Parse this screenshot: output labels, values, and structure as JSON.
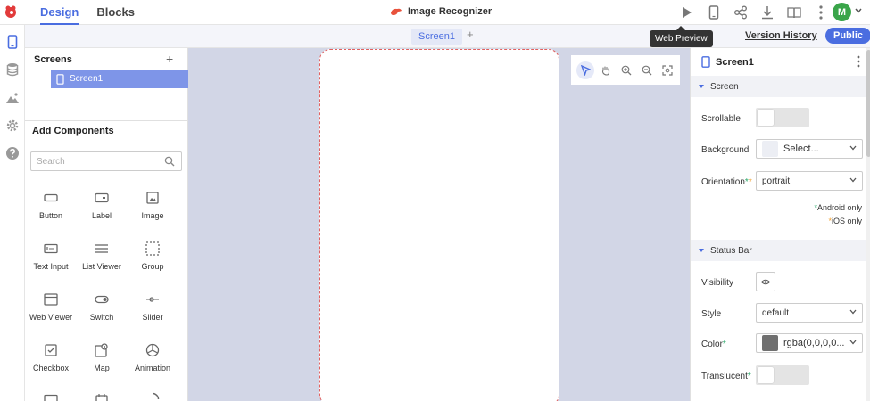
{
  "topbar": {
    "tabs": [
      {
        "label": "Design"
      },
      {
        "label": "Blocks"
      }
    ],
    "project_name": "Image Recognizer",
    "avatar_letter": "M"
  },
  "tabbar": {
    "screen_tab": "Screen1",
    "add": "+",
    "tooltip": "Web Preview",
    "version_history": "Version History",
    "public": "Public"
  },
  "screens_panel": {
    "title": "Screens",
    "add": "+",
    "items": [
      {
        "label": "Screen1"
      }
    ]
  },
  "components_panel": {
    "title": "Add Components",
    "search_placeholder": "Search",
    "items": [
      {
        "label": "Button",
        "icon": "button-icon"
      },
      {
        "label": "Label",
        "icon": "label-icon"
      },
      {
        "label": "Image",
        "icon": "image-icon"
      },
      {
        "label": "Text Input",
        "icon": "text-input-icon"
      },
      {
        "label": "List Viewer",
        "icon": "list-icon"
      },
      {
        "label": "Group",
        "icon": "group-icon"
      },
      {
        "label": "Web Viewer",
        "icon": "web-viewer-icon"
      },
      {
        "label": "Switch",
        "icon": "switch-icon"
      },
      {
        "label": "Slider",
        "icon": "slider-icon"
      },
      {
        "label": "Checkbox",
        "icon": "checkbox-icon"
      },
      {
        "label": "Map",
        "icon": "map-icon"
      },
      {
        "label": "Animation",
        "icon": "animation-icon"
      }
    ]
  },
  "properties": {
    "title": "Screen1",
    "screen_section": "Screen",
    "scrollable_label": "Scrollable",
    "background_label": "Background",
    "background_value": "Select...",
    "orientation_label": "Orientation",
    "orientation_value": "portrait",
    "android_note": "Android only",
    "ios_note": "iOS only",
    "status_section": "Status Bar",
    "visibility_label": "Visibility",
    "style_label": "Style",
    "style_value": "default",
    "color_label": "Color",
    "color_value": "rgba(0,0,0,0...",
    "translucent_label": "Translucent"
  },
  "colors": {
    "accent": "#4a6de0",
    "avatar": "#3aa54a",
    "required": "#2aa86a",
    "ios": "#f0a030",
    "status_color_swatch": "#707070"
  }
}
